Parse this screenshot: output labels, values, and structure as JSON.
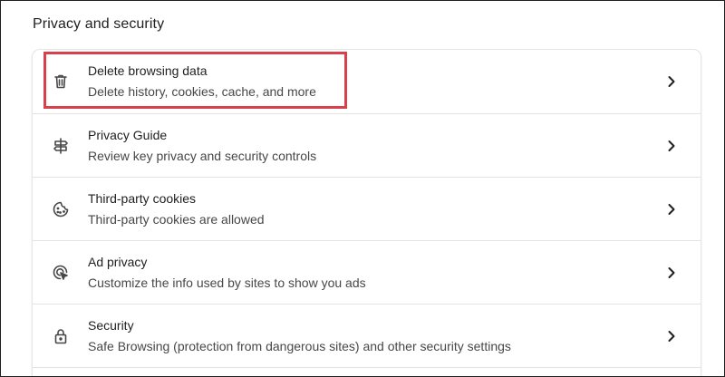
{
  "section": {
    "title": "Privacy and security"
  },
  "items": [
    {
      "title": "Delete browsing data",
      "subtitle": "Delete history, cookies, cache, and more",
      "icon": "trash-icon"
    },
    {
      "title": "Privacy Guide",
      "subtitle": "Review key privacy and security controls",
      "icon": "signpost-icon"
    },
    {
      "title": "Third-party cookies",
      "subtitle": "Third-party cookies are allowed",
      "icon": "cookie-icon"
    },
    {
      "title": "Ad privacy",
      "subtitle": "Customize the info used by sites to show you ads",
      "icon": "ad-target-icon"
    },
    {
      "title": "Security",
      "subtitle": "Safe Browsing (protection from dangerous sites) and other security settings",
      "icon": "lock-icon"
    }
  ],
  "colors": {
    "text_primary": "#1f1f1f",
    "text_secondary": "#474747",
    "divider": "#e3e3e3",
    "highlight": "#d9414a"
  }
}
